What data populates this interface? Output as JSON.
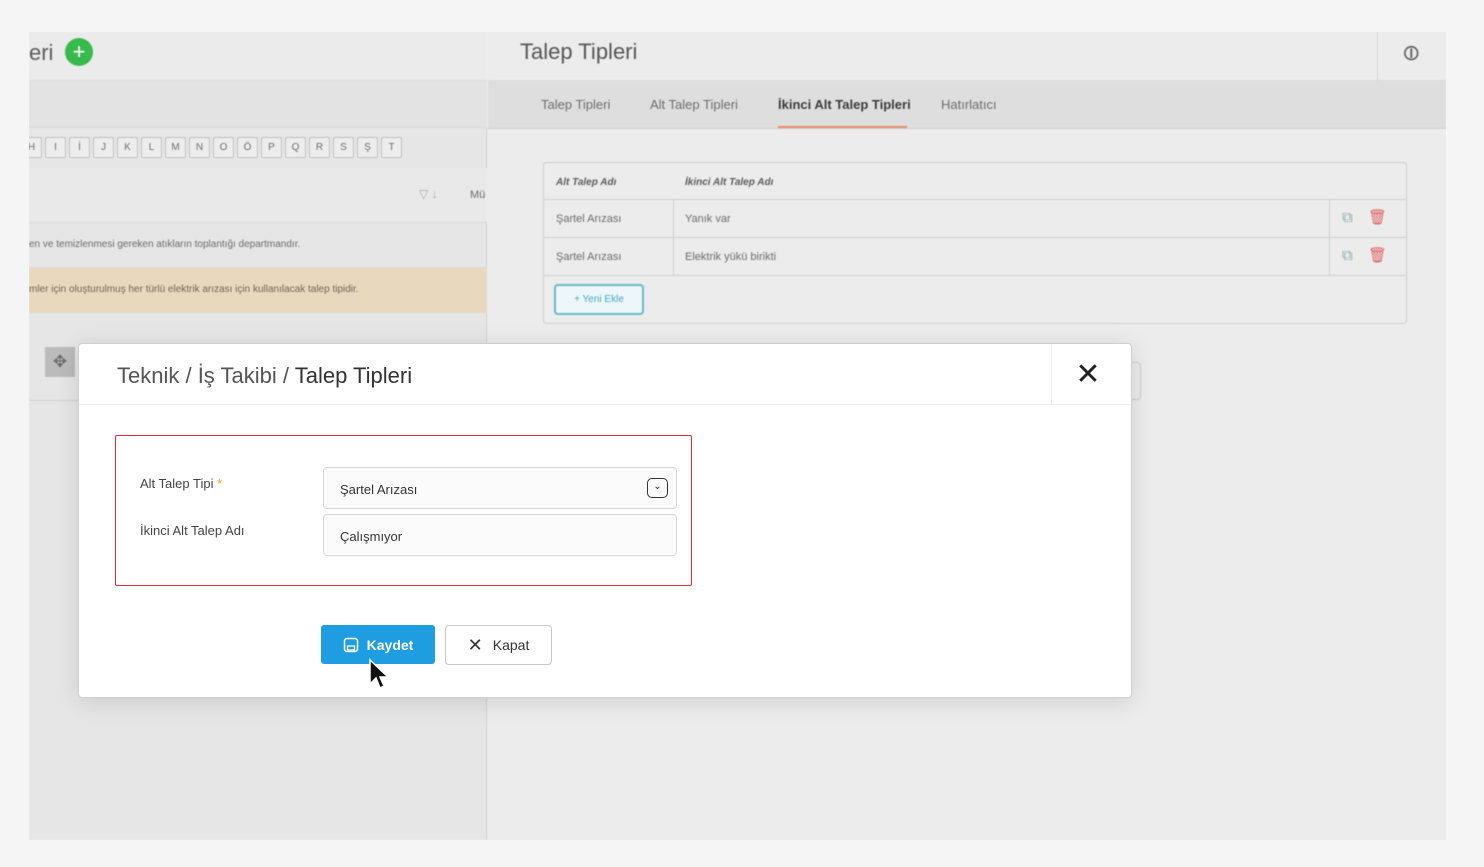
{
  "left_pane": {
    "title": "eri",
    "letters": [
      "H",
      "I",
      "İ",
      "J",
      "K",
      "L",
      "M",
      "N",
      "O",
      "Ö",
      "P",
      "Q",
      "R",
      "S",
      "Ş",
      "T"
    ],
    "column_fragment": "Mü",
    "rows": [
      "en ve temizlenmesi gereken atıkların toplantığı departmandır.",
      "mler için oluşturulmuş her türlü elektrik arızası için kullanılacak talep tipidir."
    ]
  },
  "right_pane": {
    "title": "Talep Tipleri",
    "tabs": [
      "Talep Tipleri",
      "Alt Talep Tipleri",
      "İkinci Alt Talep Tipleri",
      "Hatırlatıcı"
    ],
    "active_tab": "İkinci Alt Talep Tipleri",
    "table": {
      "columns": [
        "Alt Talep Adı",
        "İkinci Alt Talep Adı"
      ],
      "rows": [
        [
          "Şartel Arızası",
          "Yanık var"
        ],
        [
          "Şartel Arızası",
          "Elektrik yükü birikti"
        ]
      ],
      "new_button": "+ Yeni Ekle"
    }
  },
  "modal": {
    "breadcrumb_prefix": "Teknik / İş Takibi / ",
    "breadcrumb_current": "Talep Tipleri",
    "fields": {
      "alt_talep_label": "Alt Talep Tipi",
      "required_mark": "*",
      "alt_talep_value": "Şartel Arızası",
      "ikinci_label": "İkinci Alt Talep Adı",
      "ikinci_value": "Çalışmıyor"
    },
    "buttons": {
      "save": "Kaydet",
      "close": "Kapat"
    }
  },
  "colors": {
    "primary": "#1e9ee0",
    "error_border": "#d9323c",
    "required": "#f2a01e",
    "tab_underline": "#e88a5c",
    "add_green": "#2fb844"
  }
}
